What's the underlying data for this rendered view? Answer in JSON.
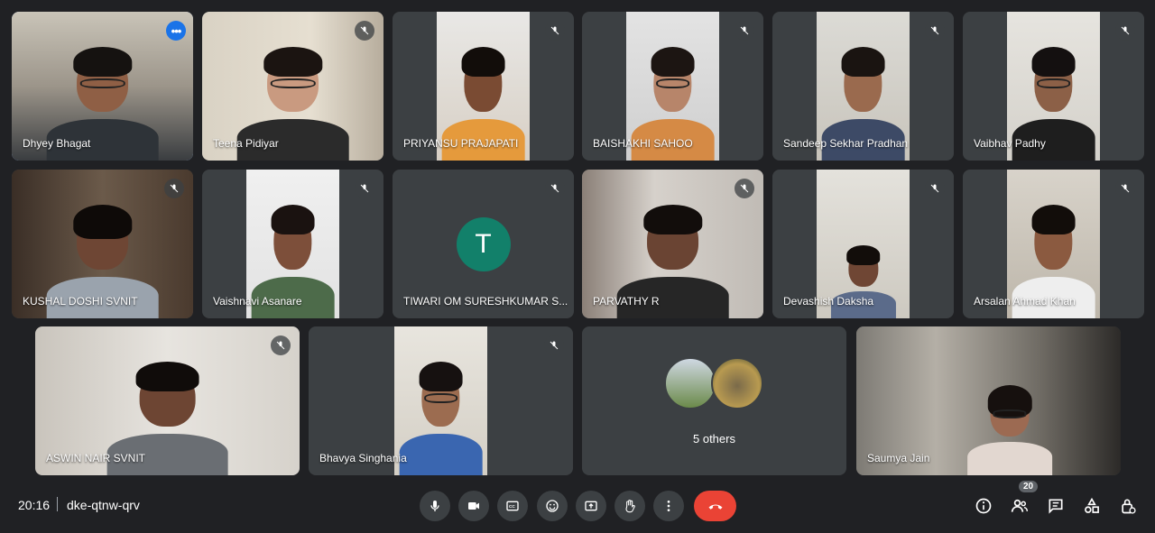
{
  "participants": [
    {
      "name": "Dhyey Bhagat"
    },
    {
      "name": "Teena Pidiyar"
    },
    {
      "name": "PRIYANSU PRAJAPATI"
    },
    {
      "name": "BAISHAKHI SAHOO"
    },
    {
      "name": "Sandeep Sekhar Pradhan"
    },
    {
      "name": "Vaibhav Padhy"
    },
    {
      "name": "KUSHAL DOSHI SVNIT"
    },
    {
      "name": "Vaishnavi Asanare"
    },
    {
      "name": "TIWARI OM SURESHKUMAR S..."
    },
    {
      "name": "PARVATHY R"
    },
    {
      "name": "Devashish Daksha"
    },
    {
      "name": "Arsalan Ahmad Khan"
    },
    {
      "name": "ASWIN NAIR SVNIT"
    },
    {
      "name": "Bhavya Singhania"
    },
    {
      "name": "Saumya Jain"
    }
  ],
  "avatar_initial": "T",
  "others_label": "5 others",
  "meeting": {
    "time": "20:16",
    "code": "dke-qtnw-qrv"
  },
  "people_count": "20",
  "icons": {
    "mic": "mic-icon",
    "camera": "video-camera-icon",
    "captions": "captions-icon",
    "emoji": "emoji-icon",
    "present": "present-screen-icon",
    "hand": "raise-hand-icon",
    "more": "more-vert-icon",
    "end": "end-call-icon",
    "info": "info-icon",
    "people": "people-icon",
    "chat": "chat-icon",
    "activities": "activities-icon",
    "host": "host-controls-icon",
    "muted": "mic-off-icon"
  },
  "colors": {
    "end_call": "#ea4335",
    "active_outline": "#8ab4f8",
    "avatar_bg": "#12806a"
  }
}
